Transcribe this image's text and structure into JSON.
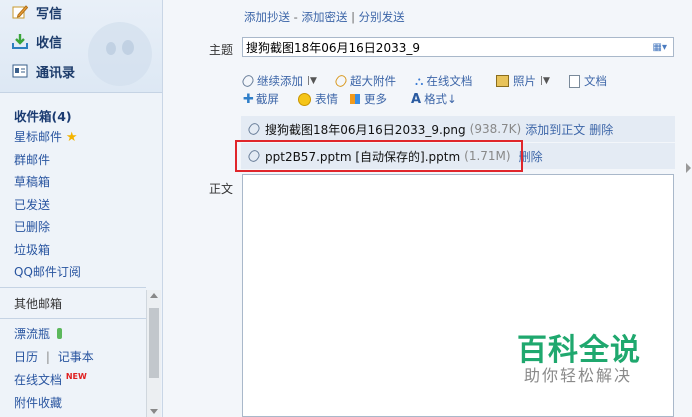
{
  "sidebar": {
    "compose": "写信",
    "inbox_action": "收信",
    "contacts": "通讯录",
    "folders": {
      "inbox": "收件箱(4)",
      "starred": "星标邮件",
      "group": "群邮件",
      "drafts": "草稿箱",
      "sent": "已发送",
      "deleted": "已删除",
      "spam": "垃圾箱",
      "qq_subscribe": "QQ邮件订阅"
    },
    "other_mailboxes": "其他邮箱",
    "drift_bottle": "漂流瓶",
    "calendar": "日历",
    "divider": "|",
    "notepad": "记事本",
    "online_docs": "在线文档",
    "new_badge": "NEW",
    "attachments": "附件收藏"
  },
  "compose": {
    "cc_links": {
      "add_cc": "添加抄送",
      "dash": "-",
      "add_bcc": "添加密送",
      "sep": "|",
      "separate": "分别发送"
    },
    "subject_label": "主题",
    "subject_value": "搜狗截图18年06月16日2033_9",
    "toolbar": {
      "continue_add": "继续添加",
      "super_attach": "超大附件",
      "online_doc": "在线文档",
      "photo": "照片",
      "document": "文档",
      "screenshot": "截屏",
      "emoji": "表情",
      "more": "更多",
      "format": "格式↓"
    },
    "attachments": [
      {
        "name": "搜狗截图18年06月16日2033_9.png",
        "size": "(938.7K)",
        "op1": "添加到正文",
        "op2": "删除"
      },
      {
        "name": "ppt2B57.pptm [自动保存的].pptm",
        "size": "(1.71M)",
        "op1": "",
        "op2": "删除"
      }
    ],
    "body_label": "正文"
  },
  "watermark": {
    "title": "百科全说",
    "subtitle": "助你轻松解决"
  },
  "colors": {
    "link": "#3d66a8",
    "highlight_box": "#e0262b",
    "watermark_green": "#1fa86e"
  }
}
